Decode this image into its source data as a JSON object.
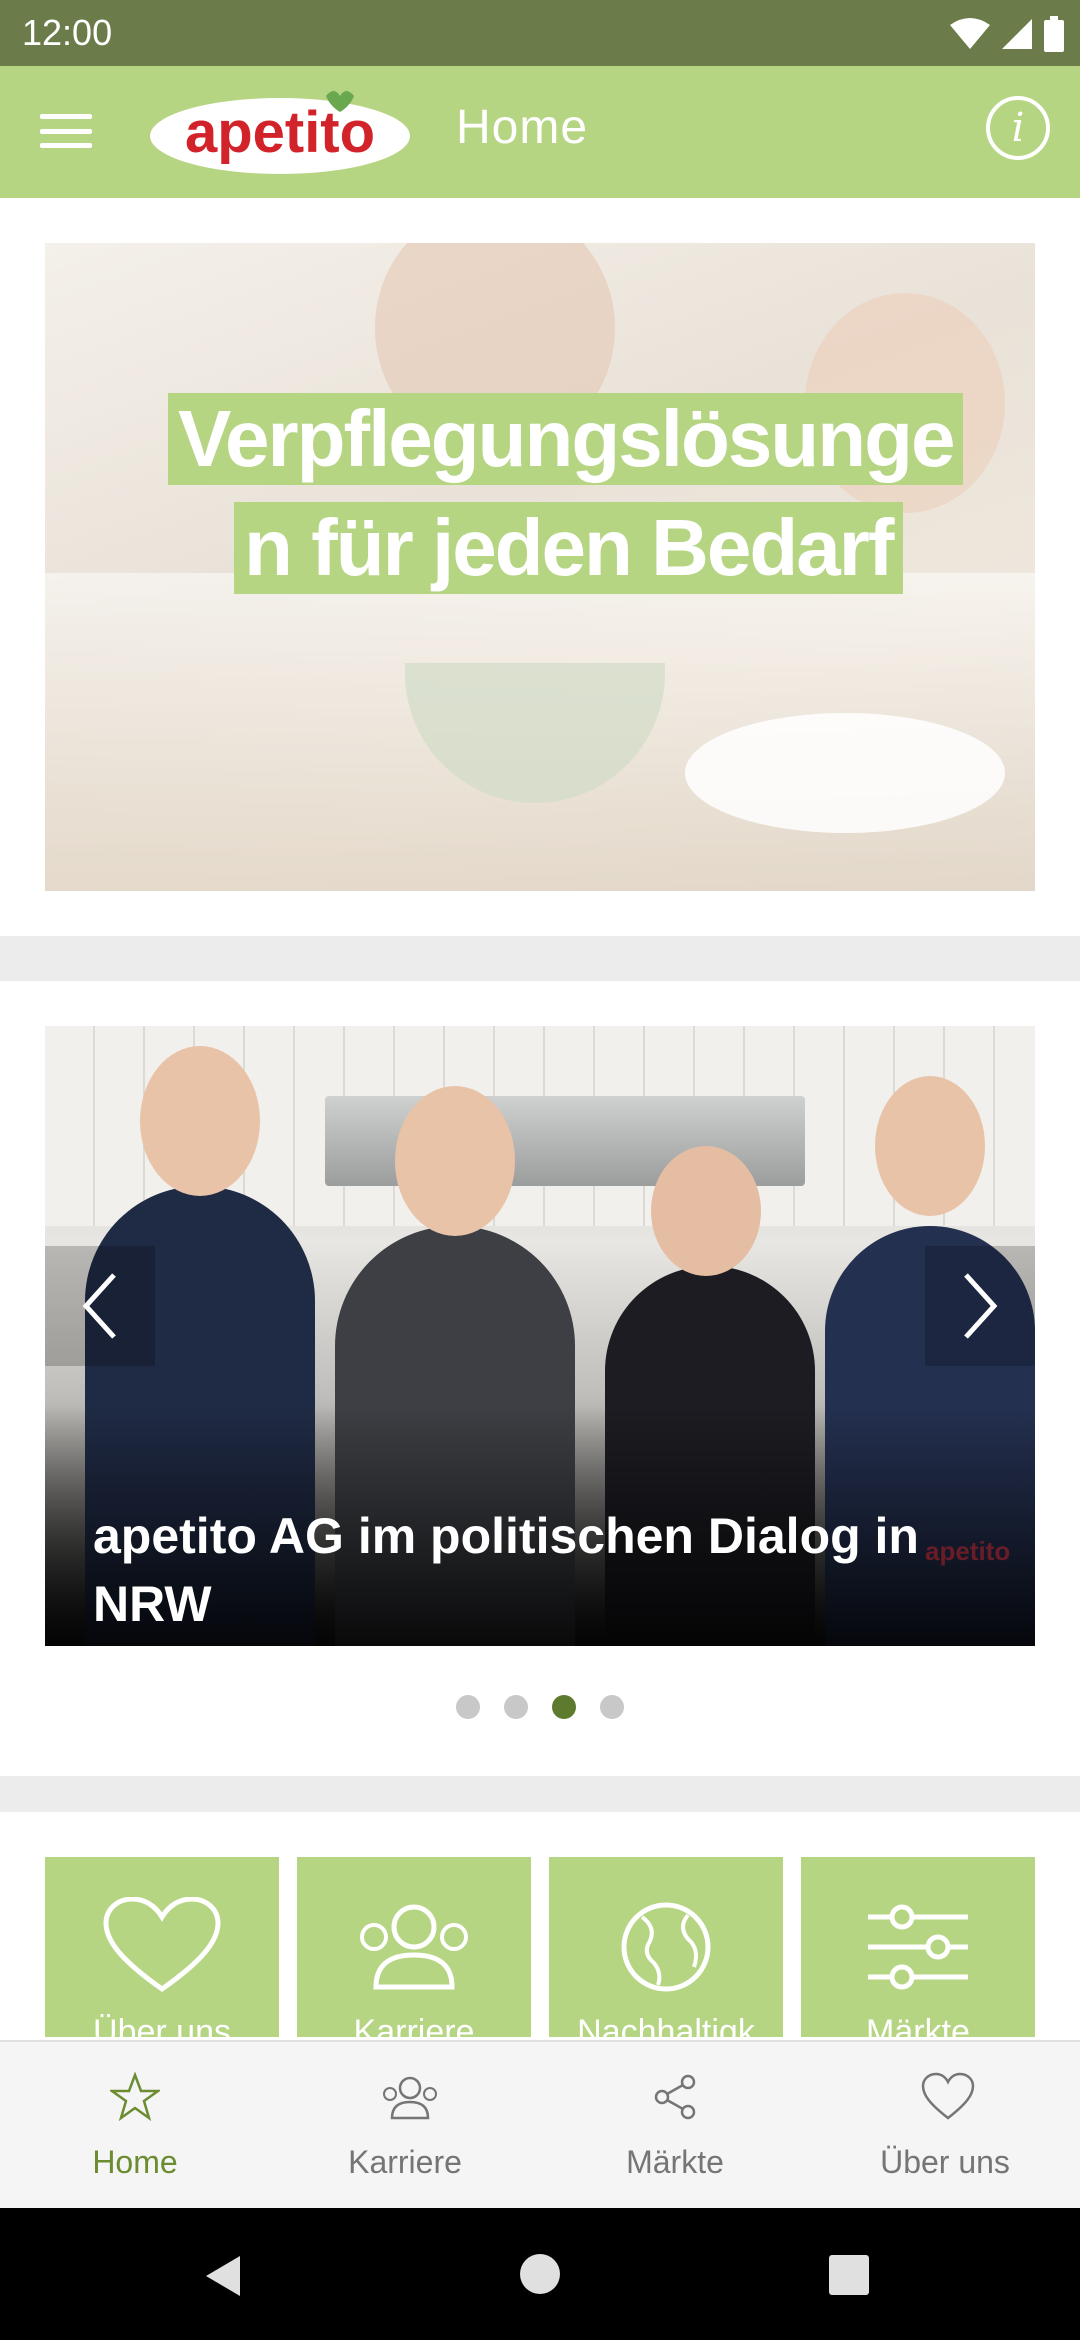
{
  "status_bar": {
    "time": "12:00"
  },
  "app_bar": {
    "logo_text": "apetito",
    "title": "Home"
  },
  "hero": {
    "line1": "Verpflegungslösunge",
    "line2": "n für jeden Bedarf"
  },
  "news": {
    "caption": "apetito AG im politischen Dialog in NRW",
    "watermark": "apetito",
    "pager": {
      "count": 4,
      "active_index": 2
    }
  },
  "tiles": [
    {
      "label": "Über uns",
      "icon": "heart-icon"
    },
    {
      "label": "Karriere",
      "icon": "team-icon"
    },
    {
      "label": "Nachhaltigk",
      "icon": "globe-icon"
    },
    {
      "label": "Märkte",
      "icon": "sliders-icon"
    }
  ],
  "bottom_nav": [
    {
      "label": "Home",
      "icon": "star-icon",
      "active": true
    },
    {
      "label": "Karriere",
      "icon": "team-icon",
      "active": false
    },
    {
      "label": "Märkte",
      "icon": "share-icon",
      "active": false
    },
    {
      "label": "Über uns",
      "icon": "heart-icon",
      "active": false
    }
  ],
  "colors": {
    "status_bar": "#6b7b4a",
    "accent": "#b5d583",
    "active_nav": "#6c8c32",
    "active_dot": "#5d7a2e"
  }
}
